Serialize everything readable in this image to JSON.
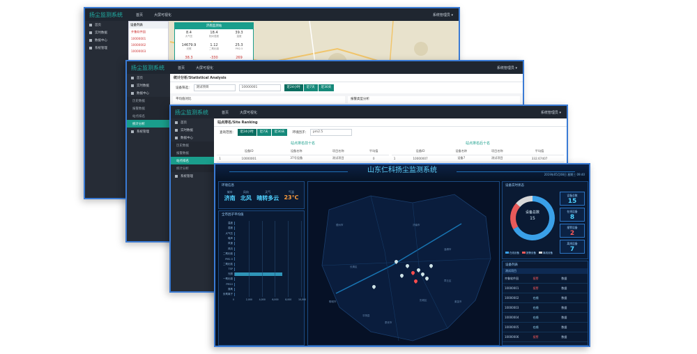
{
  "app": {
    "title": "扬尘监测系统"
  },
  "nav": {
    "home": "首页",
    "bigscreen": "大屏可视化",
    "user": "系统管理员 ▾"
  },
  "sidebar": {
    "home": "首页",
    "realtime": "实时数据",
    "data_center": "数据中心",
    "sub_history": "历史数据",
    "sub_alarm": "报警数据",
    "sub_ranking": "站点排名",
    "sub_stats": "统计分析",
    "sys": "系统管理",
    "sub_account": "账号管理",
    "sub_station": "站点管理",
    "sub_device": "设备管理"
  },
  "screen1": {
    "devices_header": "设备列表",
    "devices": [
      "齐鲁软件园",
      "10000001",
      "10000002",
      "10000003"
    ],
    "popup_title": "济南监测站",
    "popup": [
      {
        "v": "8.4",
        "k": "大气压"
      },
      {
        "v": "18.4",
        "k": "相对湿度"
      },
      {
        "v": "39.3",
        "k": "温度"
      },
      {
        "v": "14679.9",
        "k": "光照"
      },
      {
        "v": "1.12",
        "k": "二氧化碳"
      },
      {
        "v": "25.3",
        "k": "PM2.5"
      },
      {
        "v": "38.3",
        "k": "PM10"
      },
      {
        "v": "-330",
        "k": "风向"
      },
      {
        "v": "269",
        "k": "风速"
      }
    ]
  },
  "screen2": {
    "page_title": "统计分析/Statistical Analysis",
    "label_station": "设备筛选：",
    "sel_station": "测试项目",
    "sel_device": "10000001",
    "btns": [
      "近24小时",
      "近7天",
      "近30天"
    ],
    "chart_left": "平均值对比",
    "chart_right": "报警类型分析"
  },
  "screen3": {
    "page_title": "站点排名/Site Ranking",
    "label_range": "查询范围：",
    "btns": [
      "近24小时",
      "近7天",
      "近30天"
    ],
    "label_factor": "环境因子：",
    "sel_factor": "pm2.5",
    "top_title": "站点排名前十名",
    "bottom_title": "站点排名后十名",
    "cols": [
      "",
      "设备ID",
      "设备名称",
      "项目名称",
      "平均值"
    ],
    "row_left": [
      "1",
      "10000001",
      "37号设备",
      "测试项目",
      "0"
    ],
    "row_right": [
      "1",
      "10000007",
      "设备7",
      "测试项目",
      "332.67407"
    ]
  },
  "dashboard": {
    "title": "山东仁科扬尘监测系统",
    "datetime": "2019年05月08日 星期三 09:40",
    "env_title": "环境信息",
    "env": [
      {
        "k": "城市",
        "v": "济南"
      },
      {
        "k": "风向",
        "v": "北风"
      },
      {
        "k": "天气",
        "v": "晴转多云"
      },
      {
        "k": "气温",
        "v": "23℃"
      }
    ],
    "avg_title": "全市因子平均值",
    "bar_labels": [
      "温度",
      "湿度",
      "大气压",
      "噪声",
      "风速",
      "风向",
      "二氧化硫",
      "PM2.5",
      "二氧化氮",
      "TSP",
      "光照",
      "一氧化碳",
      "PM10",
      "臭氧",
      "负氧离子"
    ],
    "bar_values": [
      0,
      0,
      0,
      0,
      0,
      0,
      0,
      0,
      0,
      0,
      7200,
      0,
      0,
      0,
      0
    ],
    "x_ticks": [
      "0",
      "2,000",
      "4,000",
      "6,000",
      "8,000",
      "10,000"
    ],
    "status_title": "设备实时状态",
    "donut_label": "设备总数",
    "donut_total": "15",
    "donut": {
      "online": 10,
      "alarm": 3,
      "offline": 2
    },
    "legend": [
      "在线设备",
      "报警设备",
      "离线设备"
    ],
    "stats": [
      {
        "k": "设备总数",
        "v": "15"
      },
      {
        "k": "在线设备",
        "v": "8"
      },
      {
        "k": "报警设备",
        "v": "2"
      },
      {
        "k": "离线设备",
        "v": "7"
      }
    ],
    "devlist_title": "设备列表",
    "devlist_group": "测试项目",
    "devlist": [
      {
        "name": "齐鲁软件园",
        "state": "报警",
        "act": "数据"
      },
      {
        "name": "10000001",
        "state": "报警",
        "act": "数据"
      },
      {
        "name": "10000002",
        "state": "在线",
        "act": "数据"
      },
      {
        "name": "10000003",
        "state": "在线",
        "act": "数据"
      },
      {
        "name": "10000004",
        "state": "在线",
        "act": "数据"
      },
      {
        "name": "10000005",
        "state": "在线",
        "act": "数据"
      },
      {
        "name": "10000006",
        "state": "报警",
        "act": "数据"
      }
    ],
    "map_labels": [
      "德州市",
      "济南市",
      "泰安市",
      "淄博市",
      "聊城市",
      "莱芜市",
      "历城区",
      "章丘区",
      "长清区",
      "平阴县"
    ]
  }
}
